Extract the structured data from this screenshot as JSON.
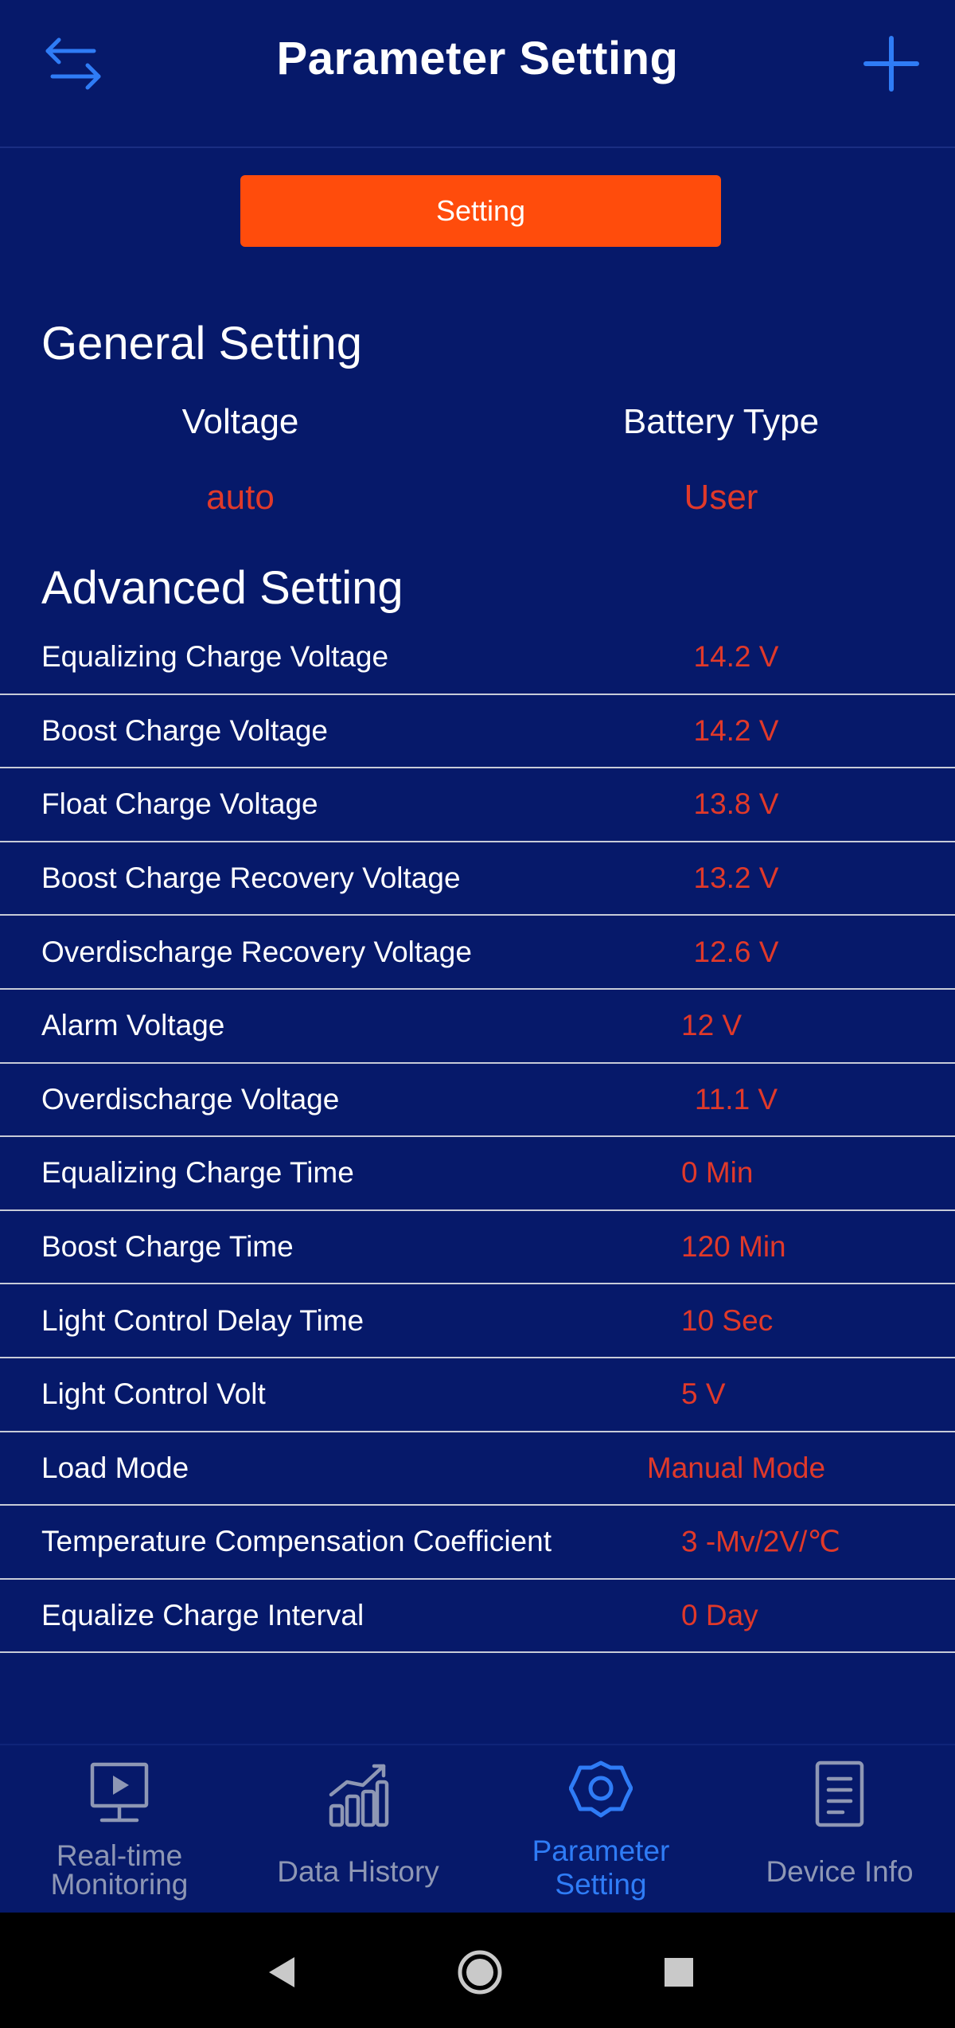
{
  "header": {
    "title": "Parameter Setting",
    "left_icon": "swap-arrows-icon",
    "right_icon": "plus-icon",
    "accent_color": "#2f7cf6"
  },
  "setting_button": {
    "label": "Setting",
    "color": "#ff4c0c"
  },
  "general": {
    "title": "General Setting",
    "columns": [
      {
        "label": "Voltage",
        "value": "auto"
      },
      {
        "label": "Battery Type",
        "value": "User"
      }
    ]
  },
  "advanced": {
    "title": "Advanced Setting",
    "rows": [
      {
        "label": "Equalizing Charge Voltage",
        "value": "14.2 V"
      },
      {
        "label": "Boost Charge Voltage",
        "value": "14.2 V"
      },
      {
        "label": "Float Charge Voltage",
        "value": "13.8 V"
      },
      {
        "label": "Boost Charge Recovery Voltage",
        "value": "13.2 V"
      },
      {
        "label": "Overdischarge Recovery Voltage",
        "value": "12.6 V"
      },
      {
        "label": "Alarm Voltage",
        "value": "12 V"
      },
      {
        "label": "Overdischarge Voltage",
        "value": "11.1 V"
      },
      {
        "label": "Equalizing Charge Time",
        "value": "0 Min"
      },
      {
        "label": "Boost Charge Time",
        "value": "120 Min"
      },
      {
        "label": "Light Control Delay Time",
        "value": "10 Sec"
      },
      {
        "label": "Light Control Volt",
        "value": "5 V"
      },
      {
        "label": "Load Mode",
        "value": "Manual Mode"
      },
      {
        "label": "Temperature Compensation Coefficient",
        "value": "3 -Mv/2V/℃"
      },
      {
        "label": "Equalize Charge Interval",
        "value": "0 Day"
      }
    ]
  },
  "bottom_nav": {
    "items": [
      {
        "label_line1": "Real-time",
        "label_line2": "Monitoring",
        "icon": "monitor-play-icon"
      },
      {
        "label_line1": "Data History",
        "label_line2": "",
        "icon": "bar-chart-icon"
      },
      {
        "label_line1": "Parameter",
        "label_line2": "Setting",
        "icon": "gear-icon",
        "active": true
      },
      {
        "label_line1": "Device Info",
        "label_line2": "",
        "icon": "document-icon"
      }
    ],
    "active_color": "#2f7cf6",
    "inactive_color": "#8e97b4"
  },
  "system_bar": {
    "buttons": [
      "back-icon",
      "home-icon",
      "recents-icon"
    ]
  },
  "colors": {
    "background": "#06196a",
    "value_text": "#e0392a",
    "divider": "#c7cbd8"
  }
}
